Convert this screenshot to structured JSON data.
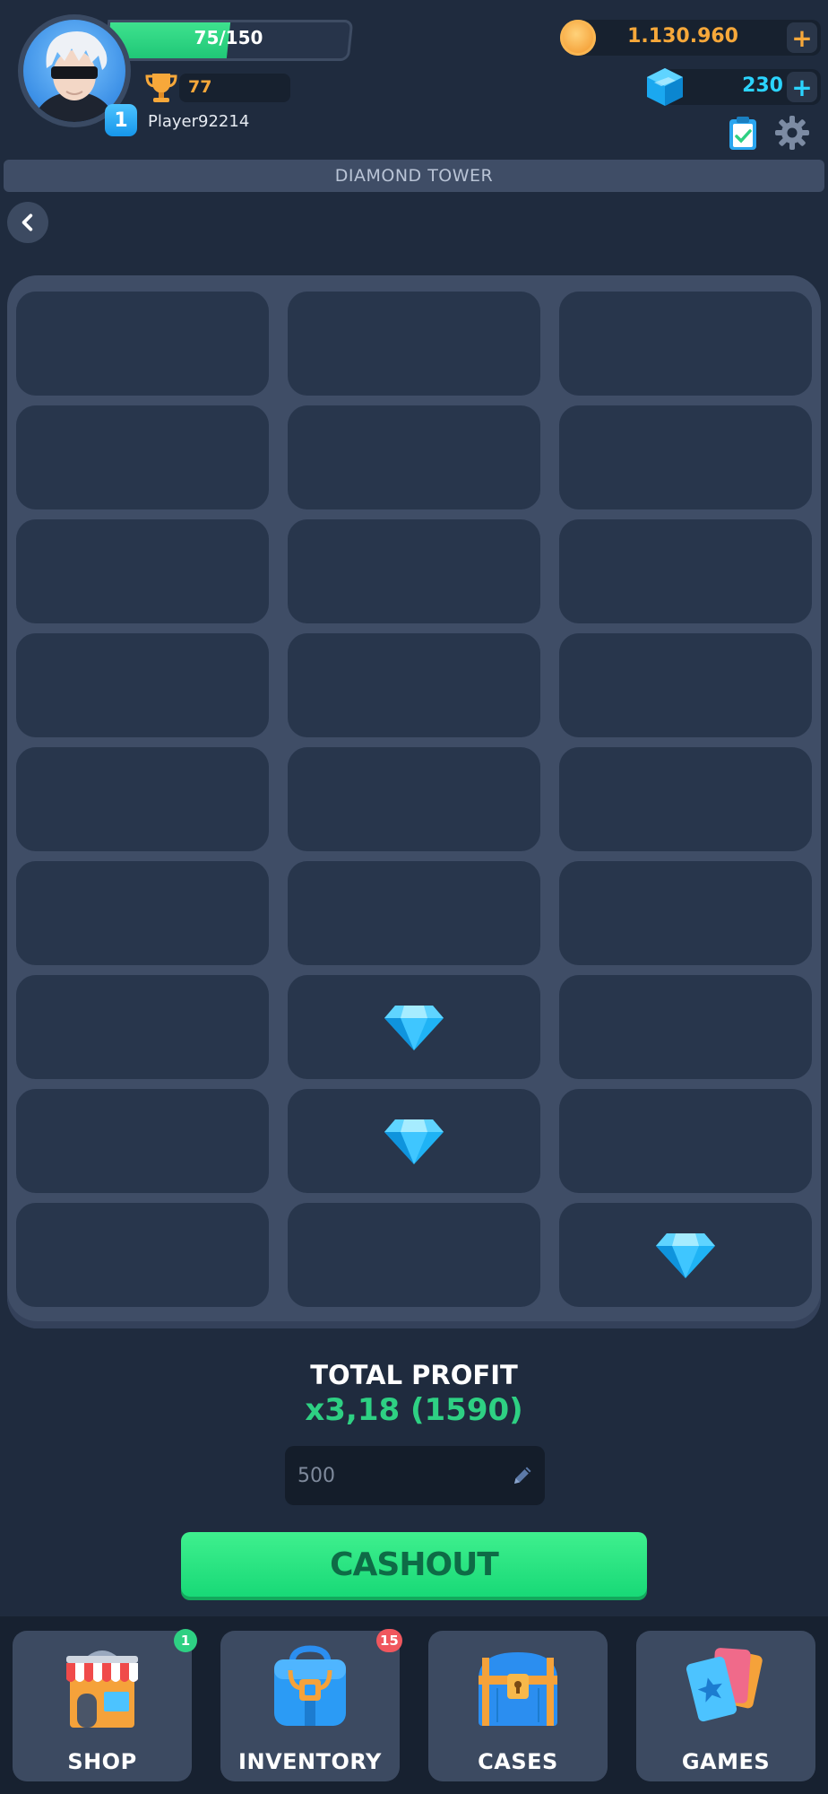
{
  "header": {
    "xp_text": "75/150",
    "xp_fraction": 0.5,
    "level": "1",
    "trophies": "77",
    "player_name": "Player92214",
    "coins": "1.130.960",
    "gems": "230",
    "plus_label": "+",
    "colors": {
      "coin": "#f7a83a",
      "gem": "#2bd4ff",
      "xp": "#2ed083"
    }
  },
  "game": {
    "title": "DIAMOND TOWER",
    "rows": 9,
    "cols": 3,
    "revealed_diamonds": [
      {
        "row": 7,
        "col": 2
      },
      {
        "row": 8,
        "col": 2
      },
      {
        "row": 9,
        "col": 3
      }
    ]
  },
  "profit": {
    "label": "TOTAL PROFIT",
    "value": "x3,18 (1590)"
  },
  "bet": {
    "value": "500"
  },
  "cashout": {
    "label": "CASHOUT"
  },
  "nav": {
    "items": [
      {
        "label": "SHOP",
        "icon": "shop-icon",
        "badge": "1",
        "badge_color": "#2ed083"
      },
      {
        "label": "INVENTORY",
        "icon": "backpack-icon",
        "badge": "15",
        "badge_color": "#f0575e"
      },
      {
        "label": "CASES",
        "icon": "chest-icon",
        "badge": "",
        "badge_color": ""
      },
      {
        "label": "GAMES",
        "icon": "cards-icon",
        "badge": "",
        "badge_color": ""
      }
    ]
  }
}
